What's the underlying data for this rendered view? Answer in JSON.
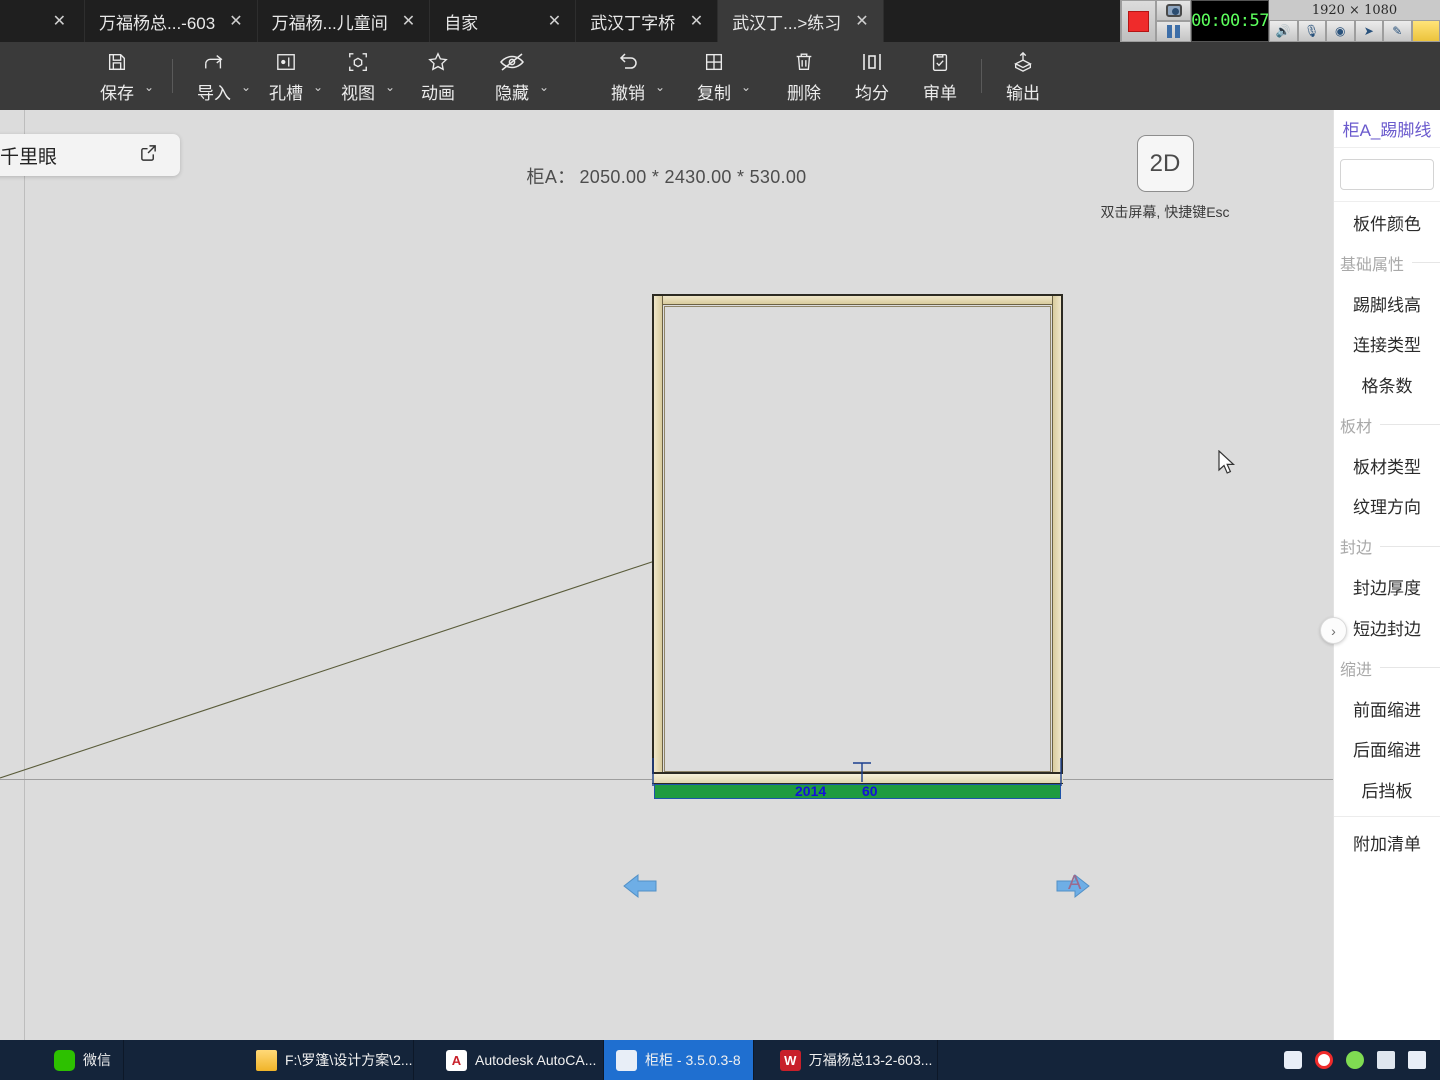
{
  "tabs": {
    "close_glyph": "✕",
    "items": [
      {
        "label": "",
        "first": true
      },
      {
        "label": "万福杨总...-603"
      },
      {
        "label": "万福杨...儿童间"
      },
      {
        "label": "自家"
      },
      {
        "label": "武汉丁字桥"
      },
      {
        "label": "武汉丁...>练习",
        "active": true
      }
    ]
  },
  "recorder": {
    "timer": "00:00:57",
    "resolution": "1920 × 1080",
    "stop_name": "stop-recording",
    "pause_name": "pause-recording"
  },
  "toolbar": {
    "items": [
      {
        "label": "保存",
        "icon": "save-icon",
        "caret": true
      },
      {
        "sep": true
      },
      {
        "label": "导入",
        "icon": "import-icon",
        "caret": true
      },
      {
        "label": "孔槽",
        "icon": "hole-slot-icon",
        "caret": true
      },
      {
        "label": "视图",
        "icon": "view-icon",
        "caret": true
      },
      {
        "label": "动画",
        "icon": "animation-icon",
        "caret": false
      },
      {
        "label": "隐藏",
        "icon": "hide-icon",
        "caret": true
      },
      {
        "label": "撤销",
        "icon": "undo-icon",
        "caret": true
      },
      {
        "label": "复制",
        "icon": "copy-icon",
        "caret": true
      },
      {
        "label": "删除",
        "icon": "delete-icon",
        "caret": false
      },
      {
        "label": "均分",
        "icon": "distribute-icon",
        "caret": false
      },
      {
        "label": "审单",
        "icon": "review-order-icon",
        "caret": false
      },
      {
        "sep": true
      },
      {
        "label": "输出",
        "icon": "export-icon",
        "caret": false
      }
    ]
  },
  "canvas": {
    "farsight_label": "千里眼",
    "farsight_icon": "external-link-icon",
    "cabinet_title_prefix": "柜A：",
    "cabinet_title_dims": "2050.00 * 2430.00 * 530.00",
    "view_cube_label": "2D",
    "view_cube_hint": "双击屏幕, 快捷键Esc",
    "dimension_width": "2014",
    "dimension_depth": "60",
    "axis_letter": "A",
    "collapse_glyph": "›"
  },
  "panel": {
    "title": "柜A_踢脚线",
    "search_value": "",
    "rows": [
      {
        "type": "row",
        "label": "板件颜色"
      },
      {
        "type": "group",
        "label": "基础属性"
      },
      {
        "type": "row",
        "label": "踢脚线高"
      },
      {
        "type": "row",
        "label": "连接类型"
      },
      {
        "type": "row",
        "label": "格条数"
      },
      {
        "type": "group",
        "label": "板材"
      },
      {
        "type": "row",
        "label": "板材类型"
      },
      {
        "type": "row",
        "label": "纹理方向"
      },
      {
        "type": "group",
        "label": "封边"
      },
      {
        "type": "row",
        "label": "封边厚度"
      },
      {
        "type": "row",
        "label": "短边封边"
      },
      {
        "type": "group",
        "label": "缩进"
      },
      {
        "type": "row",
        "label": "前面缩进"
      },
      {
        "type": "row",
        "label": "后面缩进"
      },
      {
        "type": "row",
        "label": "后挡板"
      },
      {
        "type": "div"
      },
      {
        "type": "row",
        "label": "附加清单"
      }
    ]
  },
  "taskbar": {
    "items": [
      {
        "label": "微信",
        "icon": "wechat-icon",
        "cls": "ic-wechat",
        "glyph": ""
      },
      {
        "label": "F:\\罗篷\\设计方案\\2...",
        "icon": "folder-icon",
        "cls": "ic-folder",
        "glyph": ""
      },
      {
        "label": "Autodesk AutoCA...",
        "icon": "autocad-icon",
        "cls": "ic-acad",
        "glyph": "A"
      },
      {
        "label": "柜柜 - 3.5.0.3-8",
        "icon": "guigui-icon",
        "cls": "ic-gg",
        "glyph": "",
        "active": true
      },
      {
        "label": "万福杨总13-2-603...",
        "icon": "wanfu-icon",
        "cls": "ic-wf",
        "glyph": "W"
      }
    ],
    "tray": [
      "app-icon",
      "recorder-tray-icon",
      "volume-icon",
      "network-icon",
      "usb-icon"
    ]
  },
  "colors": {
    "accent_blue": "#1212d8",
    "selection_green": "#1f9b3f",
    "wood_tan": "#d9cc9e",
    "panel_title": "#6a5acd",
    "taskbar_active": "#1f6fd0"
  }
}
